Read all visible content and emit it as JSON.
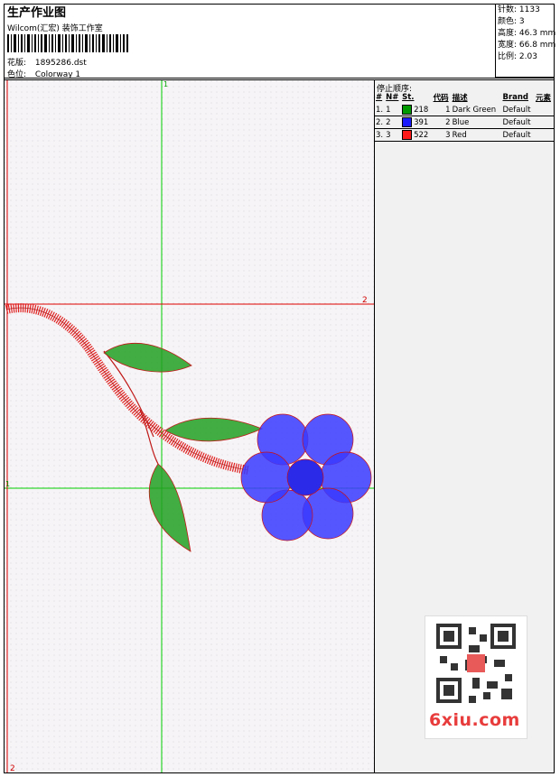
{
  "header": {
    "title": "生产作业图",
    "subtitle": "Wilcom(汇宏) 装饰工作室",
    "design_label": "花版:",
    "design_value": "1895286.dst",
    "colorway_label": "色位:",
    "colorway_value": "Colorway 1"
  },
  "stats": {
    "stitches": "针数: 1133",
    "colors": "颜色: 3",
    "height": "高度: 46.3 mm",
    "width": "宽度: 66.8 mm",
    "scale": "比例: 2.03"
  },
  "canvas": {
    "guide_top_label": "1",
    "guide_left_label": "1",
    "guide_right_label": "2",
    "guide_bottom_label": "2",
    "colors": {
      "guide": "#00d000",
      "red_guide": "#e00000",
      "background": "#f6f4f6"
    }
  },
  "stop_sequence": {
    "title": "停止顺序:",
    "headers": [
      "#",
      "N#",
      "St.",
      "代码",
      "描述",
      "Brand",
      "元素"
    ],
    "rows": [
      {
        "idx": "1.",
        "n": "1",
        "color": "#009a00",
        "stitches": "218",
        "code": "1",
        "desc": "Dark Green",
        "brand": "Default"
      },
      {
        "idx": "2.",
        "n": "2",
        "color": "#1a1aff",
        "stitches": "391",
        "code": "2",
        "desc": "Blue",
        "brand": "Default"
      },
      {
        "idx": "3.",
        "n": "3",
        "color": "#ff1a1a",
        "stitches": "522",
        "code": "3",
        "desc": "Red",
        "brand": "Default"
      }
    ]
  },
  "watermark": {
    "text": "6xiu.com"
  }
}
